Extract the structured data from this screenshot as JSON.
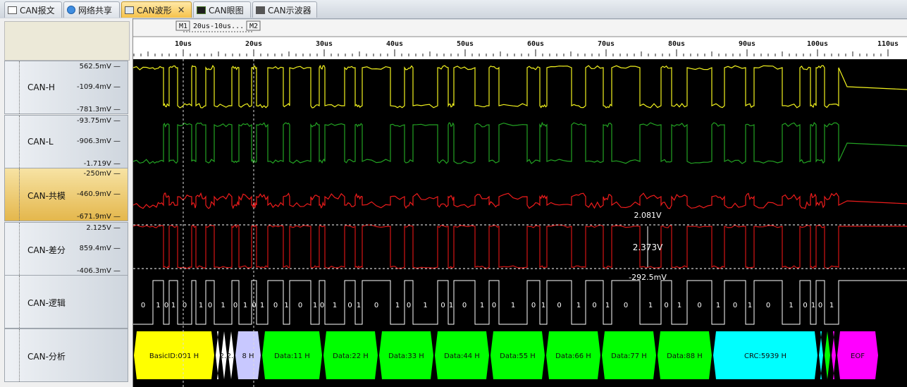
{
  "tabs": [
    {
      "label": "CAN报文",
      "icon": "table-icon"
    },
    {
      "label": "网络共享",
      "icon": "globe-icon"
    },
    {
      "label": "CAN波形",
      "icon": "waveform-icon",
      "active": true
    },
    {
      "label": "CAN眼图",
      "icon": "eye-diagram-icon"
    },
    {
      "label": "CAN示波器",
      "icon": "oscilloscope-icon"
    }
  ],
  "close_glyph": "×",
  "markers": {
    "m1": "M1",
    "m2": "M2",
    "delta": "20us-10us..."
  },
  "time_axis": {
    "unit": "us",
    "ticks": [
      "10us",
      "20us",
      "30us",
      "40us",
      "50us",
      "60us",
      "70us",
      "80us",
      "90us",
      "100us",
      "110us"
    ]
  },
  "channels": [
    {
      "name": "CAN-H",
      "top": "562.5mV",
      "mid": "-109.4mV",
      "bottom": "-781.3mV",
      "color": "#f2f21e"
    },
    {
      "name": "CAN-L",
      "top": "-93.75mV",
      "mid": "-906.3mV",
      "bottom": "-1.719V",
      "color": "#23a323"
    },
    {
      "name": "CAN-共模",
      "top": "-250mV",
      "mid": "-460.9mV",
      "bottom": "-671.9mV",
      "color": "#ee1c1c"
    },
    {
      "name": "CAN-差分",
      "top": "2.125V",
      "mid": "859.4mV",
      "bottom": "-406.3mV",
      "color": "#d51515"
    },
    {
      "name": "CAN-逻辑",
      "top": "",
      "mid": "",
      "bottom": "",
      "color": "#ffffff"
    },
    {
      "name": "CAN-分析",
      "top": "",
      "mid": "",
      "bottom": "",
      "color": "#ffffff"
    }
  ],
  "measure": {
    "upper": "2.081V",
    "delta": "2.373V",
    "lower": "-292.5mV"
  },
  "logic_bits": [
    "0",
    "1",
    "0",
    "1",
    "0",
    "1",
    "0",
    "1",
    "0",
    "1",
    "0",
    "1",
    "0",
    "1",
    "0",
    "1",
    "0",
    "1",
    "0",
    "1",
    "0",
    "1",
    "0",
    "1",
    "0",
    "1",
    "0",
    "1",
    "0",
    "1",
    "0",
    "1",
    "0",
    "1",
    "0",
    "1",
    "0",
    "1",
    "0",
    "1",
    "0",
    "1",
    "0",
    "1",
    "0",
    "1",
    "0",
    "1",
    "0",
    "1",
    "0",
    "1",
    "0",
    "1",
    "0",
    "1",
    "0",
    "1",
    "0",
    "1",
    "1"
  ],
  "segments": [
    {
      "label": "BasicID:001 H",
      "color": "#ffff00"
    },
    {
      "label": "",
      "color": "#ffffff"
    },
    {
      "label": "2..",
      "color": "#ffffff"
    },
    {
      "label": "2..",
      "color": "#ffffff"
    },
    {
      "label": "8 H",
      "color": "#c8c8ff"
    },
    {
      "label": "Data:11 H",
      "color": "#00ff00"
    },
    {
      "label": "Data:22 H",
      "color": "#00ff00"
    },
    {
      "label": "Data:33 H",
      "color": "#00ff00"
    },
    {
      "label": "Data:44 H",
      "color": "#00ff00"
    },
    {
      "label": "Data:55 H",
      "color": "#00ff00"
    },
    {
      "label": "Data:66 H",
      "color": "#00ff00"
    },
    {
      "label": "Data:77 H",
      "color": "#00ff00"
    },
    {
      "label": "Data:88 H",
      "color": "#00ff00"
    },
    {
      "label": "CRC:5939 H",
      "color": "#00ffff"
    },
    {
      "label": "",
      "color": "#00ffff"
    },
    {
      "label": "",
      "color": "#00ff00"
    },
    {
      "label": "",
      "color": "#ff00ff"
    },
    {
      "label": "EOF",
      "color": "#ff00ff"
    }
  ]
}
